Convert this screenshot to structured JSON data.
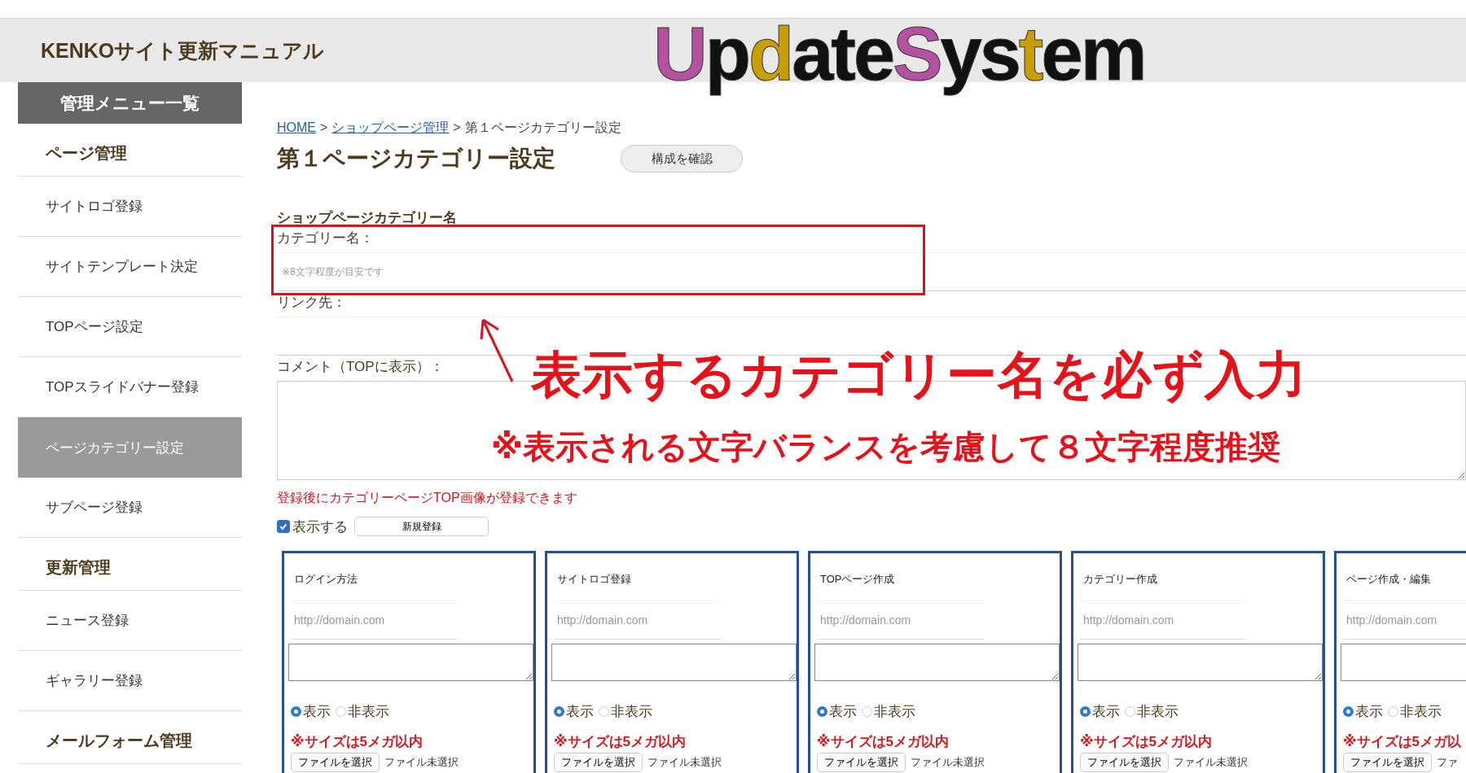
{
  "header": {
    "title": "KENKOサイト更新マニュアル",
    "logo": [
      {
        "text": "U",
        "color": "#b4529f"
      },
      {
        "text": "p",
        "color": "#111111"
      },
      {
        "text": "d",
        "color": "#c99e00"
      },
      {
        "text": "ate",
        "color": "#111111"
      },
      {
        "text": "S",
        "color": "#b4529f"
      },
      {
        "text": "ys",
        "color": "#111111"
      },
      {
        "text": "t",
        "color": "#c99e00"
      },
      {
        "text": "em",
        "color": "#111111"
      }
    ]
  },
  "sidebar": {
    "title": "管理メニュー一覧",
    "items": [
      {
        "kind": "heading",
        "label": "ページ管理"
      },
      {
        "kind": "item",
        "label": "サイトロゴ登録",
        "selected": false
      },
      {
        "kind": "item",
        "label": "サイトテンプレート決定",
        "selected": false
      },
      {
        "kind": "item",
        "label": "TOPページ設定",
        "selected": false
      },
      {
        "kind": "item",
        "label": "TOPスライドバナー登録",
        "selected": false
      },
      {
        "kind": "item",
        "label": "ページカテゴリー設定",
        "selected": true
      },
      {
        "kind": "item",
        "label": "サブページ登録",
        "selected": false
      },
      {
        "kind": "heading",
        "label": "更新管理"
      },
      {
        "kind": "item",
        "label": "ニュース登録",
        "selected": false
      },
      {
        "kind": "item",
        "label": "ギャラリー登録",
        "selected": false
      },
      {
        "kind": "heading",
        "label": "メールフォーム管理"
      }
    ]
  },
  "breadcrumb": [
    {
      "label": "HOME",
      "link": true
    },
    {
      "label": "ショップページ管理",
      "link": true
    },
    {
      "label": "第１ページカテゴリー設定",
      "link": false
    }
  ],
  "breadcrumb_separator": ">",
  "page_title": "第１ページカテゴリー設定",
  "confirm_button": "構成を確認",
  "section_title": "ショップページカテゴリー名",
  "fields": [
    {
      "label": "カテゴリー名：",
      "placeholder": "※8文字程度が目安です",
      "kind": "input"
    },
    {
      "label": "リンク先：",
      "kind": "input"
    },
    {
      "label": "コメント（TOPに表示）：",
      "kind": "textarea"
    }
  ],
  "annotation": {
    "headline": "表示するカテゴリー名を必ず入力",
    "subline": "※表示される文字バランスを考慮して８文字程度推奨"
  },
  "notice": "登録後にカテゴリーページTOP画像が登録できます",
  "display_checkbox": {
    "label": "表示する",
    "checked": true
  },
  "new_button": "新規登録",
  "cards": [
    {
      "title": "ログイン方法",
      "placeholder": "http://domain.com",
      "options": [
        {
          "label": "表示",
          "selected": true
        },
        {
          "label": "非表示",
          "selected": false
        }
      ],
      "size_note": "※サイズは5メガ以内",
      "file_button": "ファイルを選択",
      "file_status": "ファイル未選択"
    },
    {
      "title": "サイトロゴ登録",
      "placeholder": "http://domain.com",
      "options": [
        {
          "label": "表示",
          "selected": true
        },
        {
          "label": "非表示",
          "selected": false
        }
      ],
      "size_note": "※サイズは5メガ以内",
      "file_button": "ファイルを選択",
      "file_status": "ファイル未選択"
    },
    {
      "title": "TOPページ作成",
      "placeholder": "http://domain.com",
      "options": [
        {
          "label": "表示",
          "selected": true
        },
        {
          "label": "非表示",
          "selected": false
        }
      ],
      "size_note": "※サイズは5メガ以内",
      "file_button": "ファイルを選択",
      "file_status": "ファイル未選択"
    },
    {
      "title": "カテゴリー作成",
      "placeholder": "http://domain.com",
      "options": [
        {
          "label": "表示",
          "selected": true
        },
        {
          "label": "非表示",
          "selected": false
        }
      ],
      "size_note": "※サイズは5メガ以内",
      "file_button": "ファイルを選択",
      "file_status": "ファイル未選択"
    },
    {
      "title": "ページ作成・編集",
      "placeholder": "http://domain.com",
      "options": [
        {
          "label": "表示",
          "selected": true
        },
        {
          "label": "非表示",
          "selected": false
        }
      ],
      "size_note": "※サイズは5メガ以",
      "file_button": "ファイルを選択",
      "file_status": "ファ"
    }
  ]
}
